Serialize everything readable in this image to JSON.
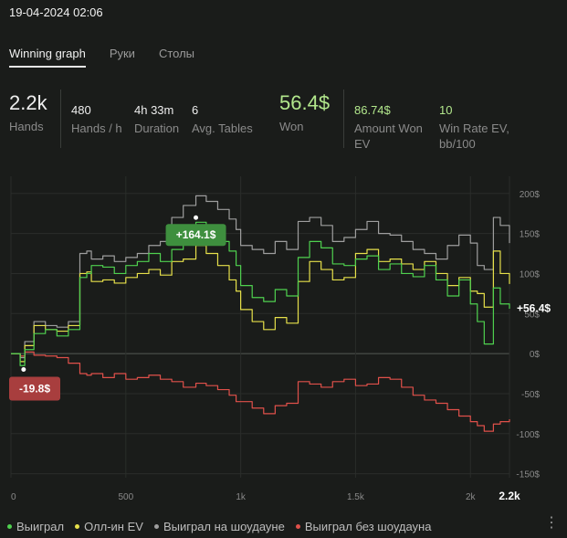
{
  "header": {
    "date": "19-04-2024 02:06"
  },
  "tabs": [
    {
      "label": "Winning graph",
      "active": true
    },
    {
      "label": "Руки",
      "active": false
    },
    {
      "label": "Столы",
      "active": false
    }
  ],
  "stats": {
    "hands": {
      "value": "2.2k",
      "label": "Hands"
    },
    "hands_per_h": {
      "value": "480",
      "label": "Hands / h"
    },
    "duration": {
      "value": "4h 33m",
      "label": "Duration"
    },
    "avg_tables": {
      "value": "6",
      "label": "Avg. Tables"
    },
    "won": {
      "value": "56.4$",
      "label": "Won"
    },
    "amount_won_ev": {
      "value": "86.74$",
      "label_line1": "Amount Won",
      "label_line2": "EV"
    },
    "win_rate_ev": {
      "value": "10",
      "label_line1": "Win Rate EV,",
      "label_line2": "bb/100"
    }
  },
  "legend": [
    {
      "label": "Выиграл",
      "color": "#4fd14f"
    },
    {
      "label": "Олл-ин EV",
      "color": "#e6e04a"
    },
    {
      "label": "Выиграл на шоудауне",
      "color": "#9e9e9e"
    },
    {
      "label": "Выиграл без шоудауна",
      "color": "#e0504a"
    }
  ],
  "more_icon": "⋮",
  "chart_data": {
    "type": "line",
    "xlim": [
      0,
      2170
    ],
    "ylim": [
      -155,
      210
    ],
    "x_ticks": [
      "0",
      "500",
      "1k",
      "1.5k",
      "2k"
    ],
    "x_tick_values": [
      0,
      500,
      1000,
      1500,
      2000
    ],
    "x_end_label": "2.2k",
    "y_ticks": [
      "200$",
      "150$",
      "100$",
      "50$",
      "0$",
      "-50$",
      "-100$",
      "-150$"
    ],
    "y_tick_values": [
      200,
      150,
      100,
      50,
      0,
      -50,
      -100,
      -150
    ],
    "annotations": [
      {
        "text": "+164.1$",
        "x": 805,
        "y": 164.1,
        "color": "#3e8f3e"
      },
      {
        "text": "-19.8$",
        "x": 40,
        "y": -19.8,
        "color": "#a83e3e"
      },
      {
        "text": "+56.4$",
        "x": 2170,
        "y": 56.4,
        "color": "transparent"
      }
    ],
    "series": [
      {
        "name": "Выиграл",
        "color": "#4fd14f",
        "x": [
          0,
          40,
          60,
          100,
          150,
          200,
          250,
          300,
          330,
          350,
          400,
          450,
          500,
          550,
          600,
          650,
          700,
          750,
          805,
          850,
          900,
          950,
          980,
          1000,
          1050,
          1100,
          1150,
          1200,
          1250,
          1300,
          1350,
          1400,
          1450,
          1500,
          1550,
          1600,
          1650,
          1700,
          1750,
          1800,
          1850,
          1900,
          1950,
          2000,
          2030,
          2060,
          2100,
          2130,
          2170
        ],
        "y": [
          0,
          -15,
          5,
          25,
          30,
          22,
          30,
          95,
          100,
          110,
          108,
          100,
          110,
          115,
          125,
          115,
          130,
          145,
          164,
          150,
          140,
          128,
          110,
          85,
          70,
          65,
          80,
          72,
          120,
          140,
          132,
          112,
          110,
          118,
          122,
          105,
          112,
          100,
          96,
          110,
          92,
          72,
          92,
          62,
          40,
          12,
          82,
          62,
          56
        ]
      },
      {
        "name": "Олл-ин EV",
        "color": "#e6e04a",
        "x": [
          0,
          40,
          60,
          100,
          150,
          200,
          250,
          300,
          330,
          350,
          400,
          450,
          500,
          550,
          600,
          650,
          700,
          750,
          805,
          850,
          900,
          950,
          980,
          1000,
          1050,
          1100,
          1150,
          1200,
          1250,
          1300,
          1350,
          1400,
          1450,
          1500,
          1550,
          1600,
          1650,
          1700,
          1750,
          1800,
          1850,
          1900,
          1950,
          2000,
          2030,
          2060,
          2100,
          2130,
          2170
        ],
        "y": [
          0,
          -10,
          10,
          35,
          30,
          28,
          35,
          100,
          102,
          90,
          92,
          88,
          95,
          100,
          105,
          98,
          115,
          118,
          135,
          125,
          110,
          92,
          78,
          55,
          40,
          30,
          45,
          38,
          90,
          115,
          105,
          92,
          95,
          125,
          130,
          115,
          118,
          112,
          105,
          115,
          100,
          85,
          95,
          78,
          75,
          58,
          128,
          100,
          87
        ]
      },
      {
        "name": "Выиграл на шоудауне",
        "color": "#9e9e9e",
        "x": [
          0,
          40,
          60,
          100,
          150,
          200,
          250,
          300,
          330,
          350,
          400,
          450,
          500,
          550,
          600,
          650,
          700,
          750,
          805,
          850,
          900,
          950,
          980,
          1000,
          1050,
          1100,
          1150,
          1200,
          1250,
          1300,
          1350,
          1400,
          1450,
          1500,
          1550,
          1600,
          1650,
          1700,
          1750,
          1800,
          1850,
          1900,
          1950,
          2000,
          2030,
          2060,
          2100,
          2130,
          2170
        ],
        "y": [
          0,
          -5,
          15,
          40,
          35,
          33,
          40,
          125,
          128,
          118,
          122,
          115,
          120,
          125,
          135,
          140,
          170,
          185,
          197,
          190,
          180,
          168,
          155,
          135,
          130,
          125,
          140,
          130,
          165,
          170,
          160,
          140,
          145,
          155,
          165,
          150,
          148,
          140,
          130,
          125,
          118,
          135,
          148,
          138,
          110,
          105,
          170,
          160,
          138
        ]
      },
      {
        "name": "Выиграл без шоудауна",
        "color": "#e0504a",
        "x": [
          0,
          40,
          60,
          100,
          150,
          200,
          250,
          300,
          330,
          350,
          400,
          450,
          500,
          550,
          600,
          650,
          700,
          750,
          805,
          850,
          900,
          950,
          980,
          1000,
          1050,
          1100,
          1150,
          1200,
          1250,
          1300,
          1350,
          1400,
          1450,
          1500,
          1550,
          1600,
          1650,
          1700,
          1750,
          1800,
          1850,
          1900,
          1950,
          2000,
          2030,
          2060,
          2100,
          2130,
          2170
        ],
        "y": [
          0,
          -3,
          2,
          -2,
          -3,
          -5,
          -12,
          -25,
          -27,
          -25,
          -30,
          -25,
          -32,
          -30,
          -27,
          -32,
          -35,
          -42,
          -37,
          -40,
          -45,
          -52,
          -60,
          -60,
          -68,
          -75,
          -65,
          -62,
          -35,
          -38,
          -42,
          -35,
          -32,
          -40,
          -38,
          -30,
          -32,
          -42,
          -52,
          -58,
          -62,
          -70,
          -78,
          -85,
          -90,
          -97,
          -88,
          -85,
          -82
        ]
      }
    ]
  }
}
